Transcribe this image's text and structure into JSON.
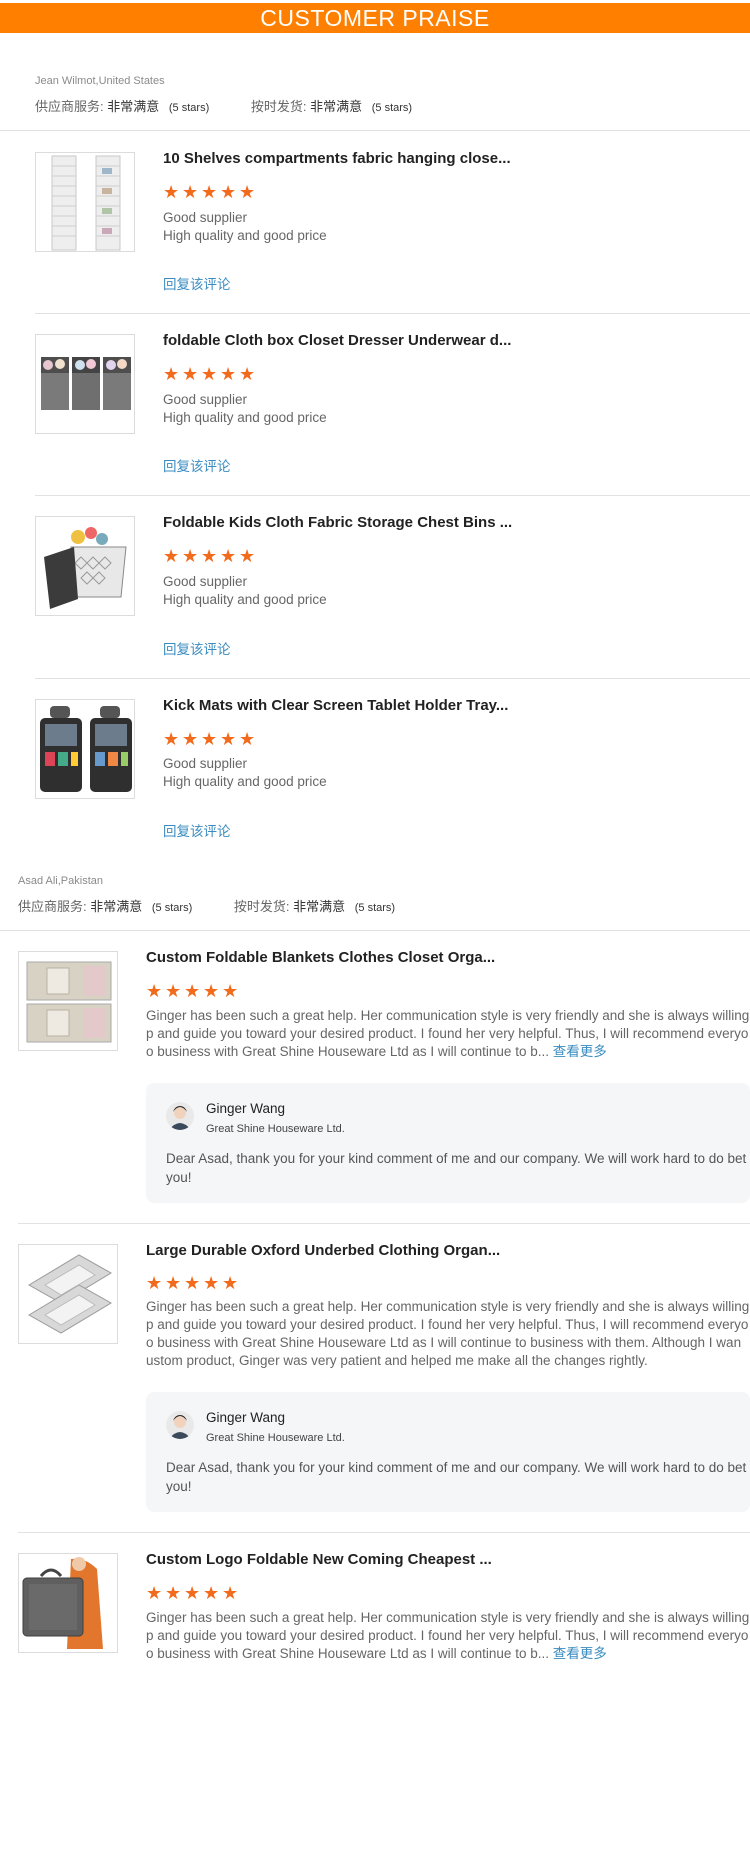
{
  "banner": {
    "title": "CUSTOMER PRAISE"
  },
  "reviews": [
    {
      "reviewer": "Jean Wilmot,United States",
      "service_label": "供应商服务:",
      "service_value": "非常满意",
      "service_stars": "(5 stars)",
      "ontime_label": "按时发货:",
      "ontime_value": "非常满意",
      "ontime_stars": "(5 stars)",
      "items": [
        {
          "title": "10 Shelves compartments fabric hanging close...",
          "rating": 5,
          "line1": "Good supplier",
          "line2": "High quality and good price",
          "reply_link": "回复该评论",
          "thumb_icon": "hanging-shelf-organizer-photo"
        },
        {
          "title": "foldable Cloth box Closet Dresser Underwear d...",
          "rating": 5,
          "line1": "Good supplier",
          "line2": "High quality and good price",
          "reply_link": "回复该评论",
          "thumb_icon": "underwear-drawer-boxes-photo"
        },
        {
          "title": "Foldable Kids Cloth Fabric Storage Chest Bins ...",
          "rating": 5,
          "line1": "Good supplier",
          "line2": "High quality and good price",
          "reply_link": "回复该评论",
          "thumb_icon": "toy-storage-chest-photo"
        },
        {
          "title": "Kick Mats with Clear Screen Tablet Holder Tray...",
          "rating": 5,
          "line1": "Good supplier",
          "line2": "High quality and good price",
          "reply_link": "回复该评论",
          "thumb_icon": "car-seat-organizer-photo"
        }
      ]
    },
    {
      "reviewer": "Asad Ali,Pakistan",
      "service_label": "供应商服务:",
      "service_value": "非常满意",
      "service_stars": "(5 stars)",
      "ontime_label": "按时发货:",
      "ontime_value": "非常满意",
      "ontime_stars": "(5 stars)",
      "items": [
        {
          "title": "Custom Foldable Blankets Clothes Closet Orga...",
          "rating": 5,
          "lines": [
            "Ginger has been such a great help. Her communication style is very friendly and she is always willing",
            "p and guide you toward your desired product. I found her very helpful. Thus, I will recommend everyo",
            "o business with Great Shine Houseware Ltd as I will continue to b..."
          ],
          "more_link": "查看更多",
          "thumb_icon": "blanket-storage-bags-photo",
          "reply": {
            "name": "Ginger Wang",
            "company": "Great Shine Houseware Ltd.",
            "line1": "Dear Asad, thank you for your kind comment of me and our company. We will work hard to do bet",
            "line2": "you!"
          }
        },
        {
          "title": "Large Durable Oxford Underbed Clothing Organ...",
          "rating": 5,
          "lines": [
            "Ginger has been such a great help. Her communication style is very friendly and she is always willing",
            "p and guide you toward your desired product. I found her very helpful. Thus, I will recommend everyo",
            "o business with Great Shine Houseware Ltd as I will continue to business with them. Although I wan",
            "ustom product, Ginger was very patient and helped me make all the changes rightly."
          ],
          "thumb_icon": "underbed-storage-bags-photo",
          "reply": {
            "name": "Ginger Wang",
            "company": "Great Shine Houseware Ltd.",
            "line1": "Dear Asad, thank you for your kind comment of me and our company. We will work hard to do bet",
            "line2": "you!"
          }
        },
        {
          "title": "Custom Logo Foldable New Coming Cheapest ...",
          "rating": 5,
          "lines": [
            "Ginger has been such a great help. Her communication style is very friendly and she is always willing",
            "p and guide you toward your desired product. I found her very helpful. Thus, I will recommend everyo",
            "o business with Great Shine Houseware Ltd as I will continue to b..."
          ],
          "more_link": "查看更多",
          "thumb_icon": "garment-bag-photo"
        }
      ]
    }
  ],
  "colors": {
    "banner": "#ff8000",
    "star": "#f26b1d",
    "link": "#3a8cc0"
  }
}
